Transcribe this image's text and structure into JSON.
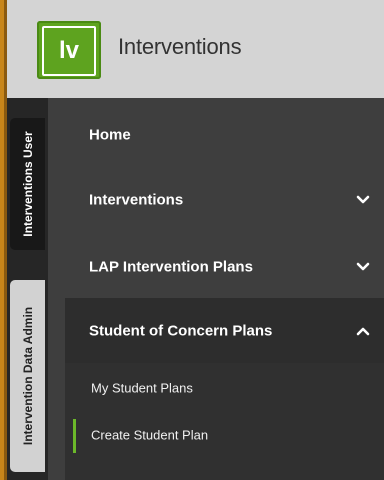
{
  "app": {
    "logo_text": "lv",
    "title": "Interventions"
  },
  "tabs": [
    {
      "label": "Interventions User"
    },
    {
      "label": "Intervention Data Admin"
    }
  ],
  "nav": {
    "items": [
      {
        "label": "Home"
      },
      {
        "label": "Interventions",
        "icon": "chevron-down-icon"
      },
      {
        "label": "LAP Intervention Plans",
        "icon": "chevron-down-icon"
      },
      {
        "label": "Student of Concern Plans",
        "icon": "chevron-up-icon"
      }
    ],
    "submenu": [
      {
        "label": "My Student Plans"
      },
      {
        "label": "Create Student Plan",
        "active": true
      }
    ]
  },
  "colors": {
    "brand_green": "#5ea31f",
    "active_indicator": "#6cb82a",
    "edge_orange": "#c8861a"
  }
}
